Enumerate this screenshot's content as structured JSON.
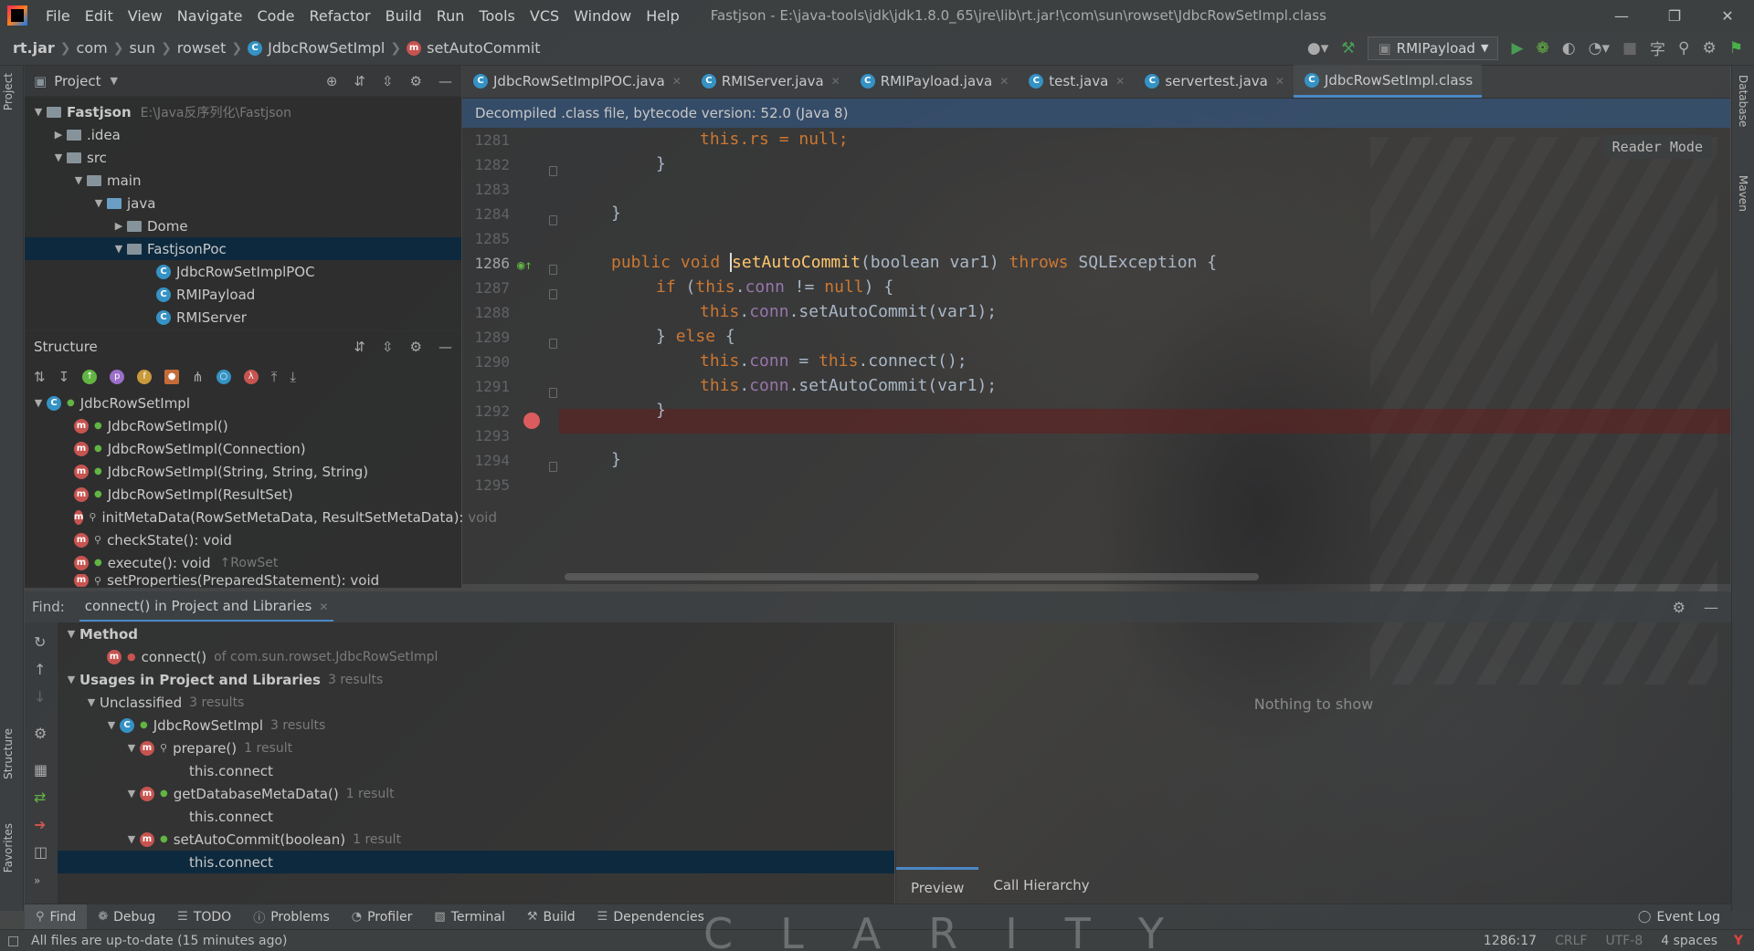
{
  "menubar": {
    "items": [
      "File",
      "Edit",
      "View",
      "Navigate",
      "Code",
      "Refactor",
      "Build",
      "Run",
      "Tools",
      "VCS",
      "Window",
      "Help"
    ],
    "title": "Fastjson - E:\\java-tools\\jdk\\jdk1.8.0_65\\jre\\lib\\rt.jar!\\com\\sun\\rowset\\JdbcRowSetImpl.class"
  },
  "navbar": {
    "crumbs": [
      "rt.jar",
      "com",
      "sun",
      "rowset",
      "JdbcRowSetImpl",
      "setAutoCommit"
    ],
    "run_config": "RMIPayload"
  },
  "left_stripe": {
    "project": "Project",
    "structure": "Structure",
    "favorites": "Favorites"
  },
  "right_stripe": {
    "database": "Database",
    "maven": "Maven"
  },
  "project_panel": {
    "title": "Project",
    "rows": [
      {
        "label": "Fastjson",
        "extra": "E:\\Java反序列化\\Fastjson"
      },
      {
        "label": ".idea"
      },
      {
        "label": "src"
      },
      {
        "label": "main"
      },
      {
        "label": "java"
      },
      {
        "label": "Dome"
      },
      {
        "label": "FastjsonPoc"
      },
      {
        "label": "JdbcRowSetImplPOC"
      },
      {
        "label": "RMIPayload"
      },
      {
        "label": "RMIServer"
      }
    ]
  },
  "structure_panel": {
    "title": "Structure",
    "root": "JdbcRowSetImpl",
    "members": [
      {
        "label": "JdbcRowSetImpl()"
      },
      {
        "label": "JdbcRowSetImpl(Connection)"
      },
      {
        "label": "JdbcRowSetImpl(String, String, String)"
      },
      {
        "label": "JdbcRowSetImpl(ResultSet)"
      },
      {
        "label": "initMetaData(RowSetMetaData, ResultSetMetaData): void"
      },
      {
        "label": "checkState(): void"
      },
      {
        "label": "execute(): void",
        "extra": "↑RowSet"
      },
      {
        "label": "setProperties(PreparedStatement): void"
      }
    ]
  },
  "editor": {
    "tabs": [
      "JdbcRowSetImplPOC.java",
      "RMIServer.java",
      "RMIPayload.java",
      "test.java",
      "servertest.java",
      "JdbcRowSetImpl.class"
    ],
    "banner": "Decompiled .class file, bytecode version: 52.0 (Java 8)",
    "reader_mode": "Reader Mode",
    "line_numbers": [
      "1281",
      "1282",
      "1283",
      "1284",
      "1285",
      "1286",
      "1287",
      "1288",
      "1289",
      "1290",
      "1291",
      "1292",
      "1293",
      "1294",
      "1295"
    ],
    "code": {
      "l1281": "this.rs = null;",
      "l1282": "}",
      "l1284": "}",
      "l1286a": "public void ",
      "l1286b": "setAutoCommit",
      "l1286c": "(boolean var1) ",
      "l1286d": "throws",
      "l1286e": " SQLException {",
      "l1287": "if (this.conn != null) {",
      "l1288": "this.conn.setAutoCommit(var1);",
      "l1289": "} else {",
      "l1290": "this.conn = this.connect();",
      "l1291": "this.conn.setAutoCommit(var1);",
      "l1292": "}",
      "l1294": "}"
    }
  },
  "find": {
    "label": "Find:",
    "tab": "connect() in Project and Libraries",
    "method_heading": "Method",
    "method_entry": "connect()",
    "method_entry_extra": "of com.sun.rowset.JdbcRowSetImpl",
    "usages": "Usages in Project and Libraries",
    "usages_count": "3 results",
    "unclassified": "Unclassified",
    "unclassified_count": "3 results",
    "class": "JdbcRowSetImpl",
    "class_count": "3 results",
    "m1": "prepare()",
    "m1_count": "1 result",
    "m2": "getDatabaseMetaData()",
    "m2_count": "1 result",
    "m3": "setAutoCommit(boolean)",
    "m3_count": "1 result",
    "usage_text": "this.connect",
    "nothing": "Nothing to show",
    "preview_tab": "Preview",
    "call_hierarchy_tab": "Call Hierarchy"
  },
  "tool_windows": [
    "Find",
    "Debug",
    "TODO",
    "Problems",
    "Profiler",
    "Terminal",
    "Build",
    "Dependencies"
  ],
  "event_log": "Event Log",
  "watermark": "CLARITY",
  "status": {
    "message": "All files are up-to-date (15 minutes ago)",
    "position": "1286:17",
    "line_sep": "CRLF",
    "encoding": "UTF-8",
    "indent": "4 spaces"
  }
}
